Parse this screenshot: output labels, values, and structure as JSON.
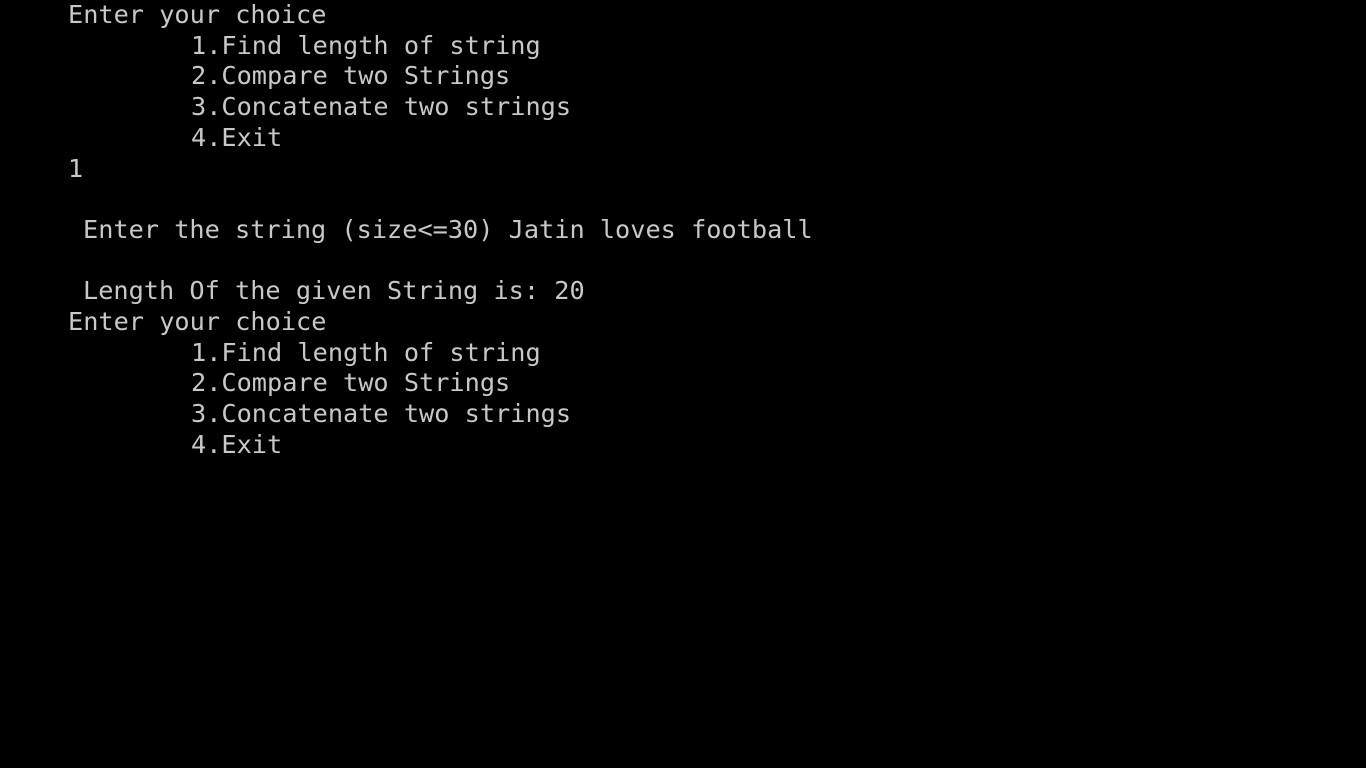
{
  "terminal": {
    "lines": [
      {
        "text": "Enter your choice"
      },
      {
        "text": "1.Find length of string"
      },
      {
        "text": "2.Compare two Strings"
      },
      {
        "text": "3.Concatenate two strings"
      },
      {
        "text": "4.Exit"
      },
      {
        "text": "1"
      },
      {
        "text": ""
      },
      {
        "text": "Enter the string (size<=30) Jatin loves football"
      },
      {
        "text": ""
      },
      {
        "text": "Length Of the given String is: 20"
      },
      {
        "text": "Enter your choice"
      },
      {
        "text": "1.Find length of string"
      },
      {
        "text": "2.Compare two Strings"
      },
      {
        "text": "3.Concatenate two strings"
      },
      {
        "text": "4.Exit"
      }
    ]
  },
  "colors": {
    "background": "#000000",
    "foreground": "#c8c8c8"
  }
}
